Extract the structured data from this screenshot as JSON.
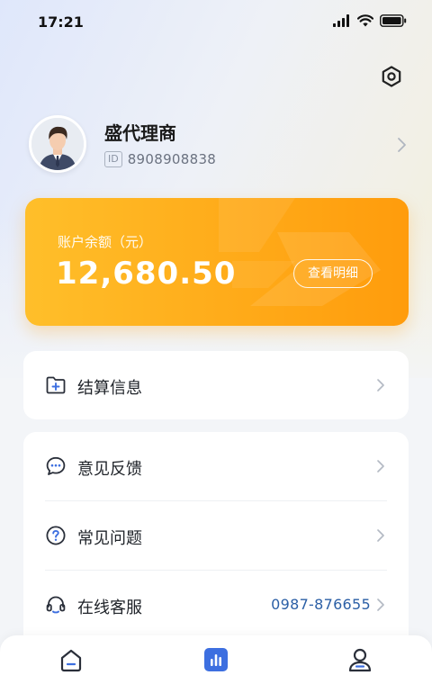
{
  "status_bar": {
    "time": "17:21"
  },
  "profile": {
    "name": "盛代理商",
    "id_badge": "ID",
    "id_value": "8908908838"
  },
  "balance": {
    "label": "账户余额（元）",
    "amount": "12,680.50",
    "detail_button": "查看明细"
  },
  "menu_primary": [
    {
      "label": "结算信息",
      "icon": "folder-add-icon"
    }
  ],
  "menu_secondary": [
    {
      "label": "意见反馈",
      "icon": "chat-bubble-icon"
    },
    {
      "label": "常见问题",
      "icon": "question-circle-icon"
    },
    {
      "label": "在线客服",
      "icon": "headset-icon",
      "phone": "0987-876655"
    }
  ],
  "tabs": [
    {
      "name": "home",
      "icon": "home-icon",
      "active": false
    },
    {
      "name": "stats",
      "icon": "bar-chart-icon",
      "active": true
    },
    {
      "name": "profile",
      "icon": "user-icon",
      "active": false
    }
  ],
  "colors": {
    "accent": "#3d6fe0",
    "card_orange_start": "#ffbf2a",
    "card_orange_end": "#ff9c0c",
    "phone": "#2b5fa6"
  }
}
